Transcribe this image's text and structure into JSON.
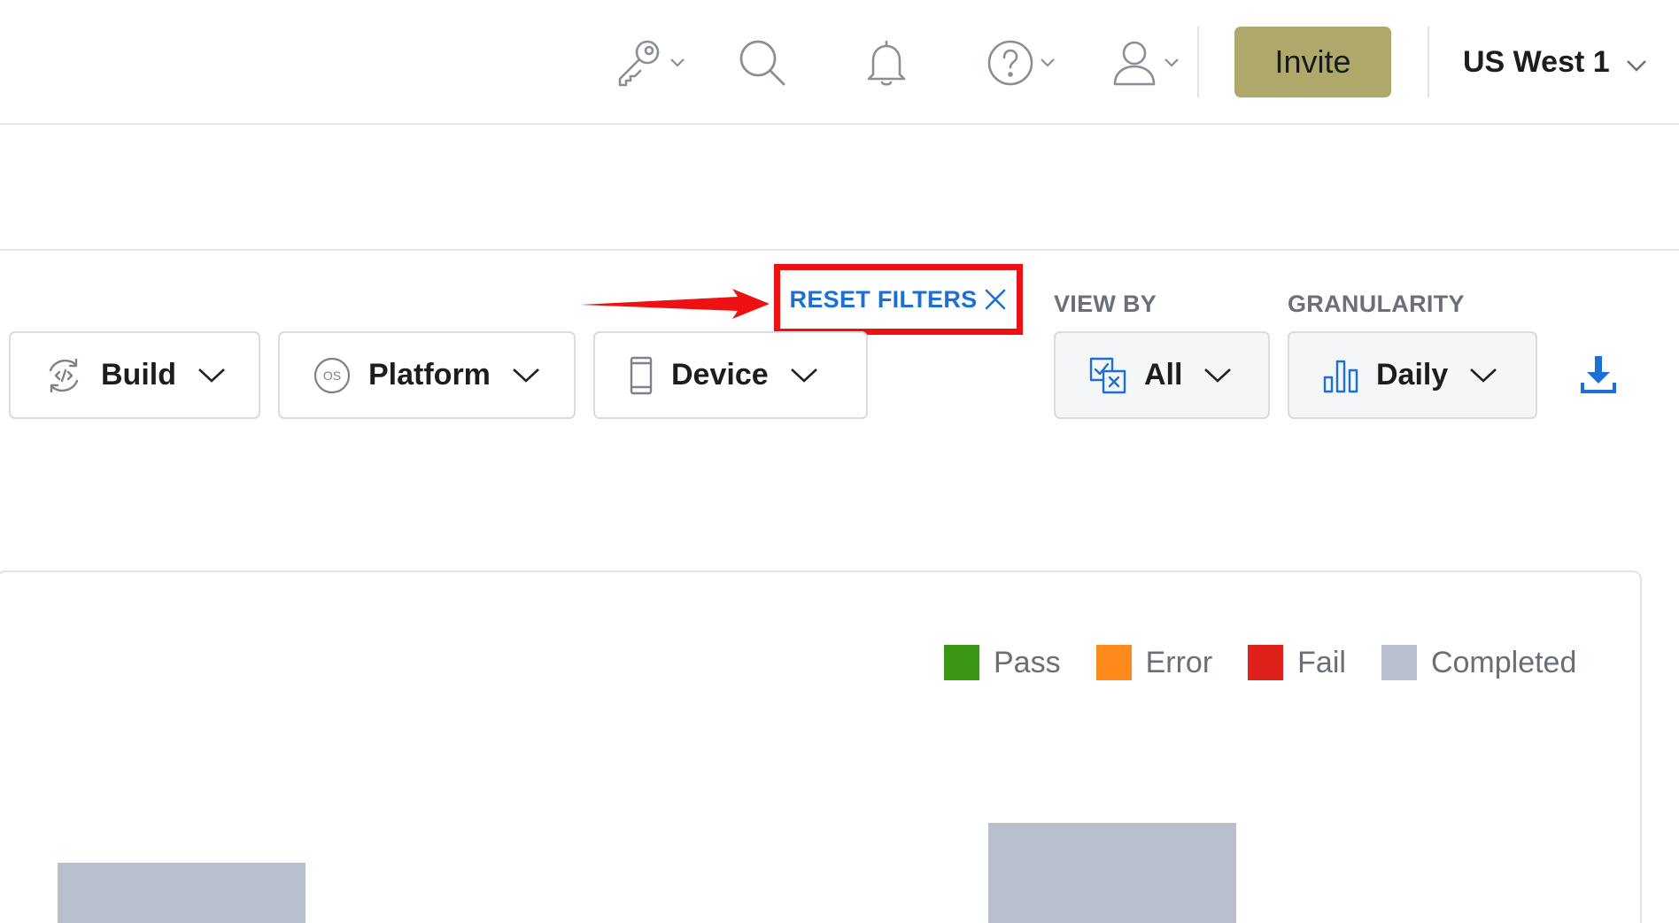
{
  "topbar": {
    "invite_label": "Invite",
    "region_label": "US West 1",
    "icons": [
      "key-icon",
      "search-icon",
      "bell-icon",
      "help-icon",
      "user-icon"
    ]
  },
  "filters": {
    "reset_label": "RESET FILTERS",
    "view_by_label": "VIEW BY",
    "granularity_label": "GRANULARITY",
    "build_label": "Build",
    "platform_label": "Platform",
    "device_label": "Device",
    "view_by_value": "All",
    "granularity_value": "Daily"
  },
  "chart": {
    "legend": [
      {
        "label": "Pass",
        "color": "#3b9614"
      },
      {
        "label": "Error",
        "color": "#ff8a1c"
      },
      {
        "label": "Fail",
        "color": "#e0201b"
      },
      {
        "label": "Completed",
        "color": "#b8bfcd"
      }
    ]
  },
  "colors": {
    "accent_blue": "#1c6fd6",
    "invite_bg": "#aea86b",
    "highlight_red": "#ee1111"
  }
}
